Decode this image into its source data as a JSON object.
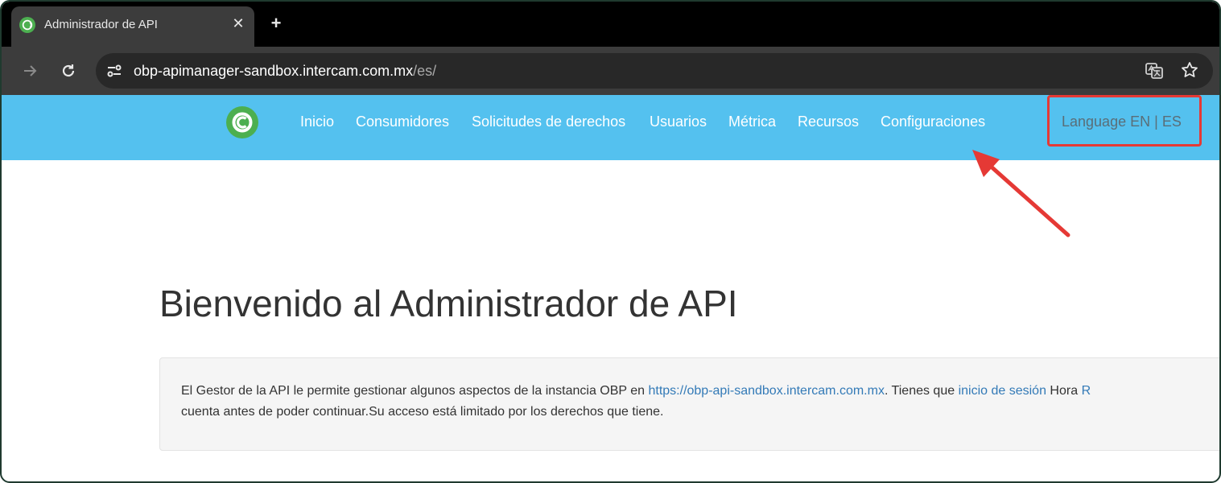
{
  "browser": {
    "tab": {
      "title": "Administrador de API",
      "close": "✕"
    },
    "new_tab": "+",
    "url": {
      "host": "obp-apimanager-sandbox.intercam.com.mx",
      "path": "/es/"
    }
  },
  "nav": {
    "items": [
      {
        "label": "Inicio"
      },
      {
        "label": "Consumidores"
      },
      {
        "label": "Solicitudes de derechos"
      },
      {
        "label": "Usuarios"
      },
      {
        "label": "Métrica"
      },
      {
        "label": "Recursos"
      },
      {
        "label": "Configuraciones"
      }
    ],
    "language_label": "Language",
    "lang_en": "EN",
    "lang_sep": "|",
    "lang_es": "ES"
  },
  "main": {
    "title": "Bienvenido al Administrador de API",
    "info": {
      "text1": "El Gestor de la API le permite gestionar algunos aspectos de la instancia OBP en ",
      "api_link": "https://obp-api-sandbox.intercam.com.mx",
      "text2": ". Tienes que ",
      "login_link": "inicio de sesión",
      "text3": " Hora ",
      "register_link": "R",
      "text4": "cuenta antes de poder continuar.Su acceso está limitado por los derechos que tiene."
    }
  },
  "colors": {
    "nav_bg": "#54c1ef",
    "highlight": "#e53935",
    "link": "#337ab7",
    "logo": "#4caf50"
  }
}
